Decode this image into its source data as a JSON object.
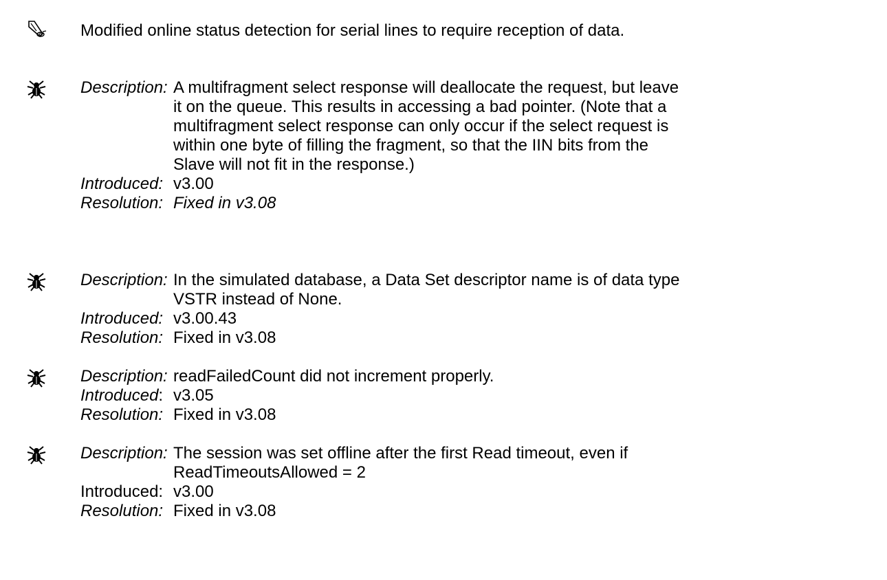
{
  "note": {
    "icon": "megaphone-icon",
    "text": "Modified online status detection for serial lines to require reception of data."
  },
  "labels": {
    "description": "Description:",
    "introduced": "Introduced:",
    "introduced_alt_colon": "Introduced",
    "colon": ":",
    "resolution": "Resolution:"
  },
  "bugs": [
    {
      "icon": "bug-spider-icon",
      "description_lines": [
        "A multifragment select response will deallocate the request, but leave",
        "it on the queue. This results in accessing a bad pointer. (Note that a",
        "multifragment select response can only occur if the select request is",
        "within one byte of filling the fragment, so that the IIN bits from the",
        "Slave will not fit in the response.)"
      ],
      "introduced": "v3.00",
      "resolution": "Fixed in v3.08"
    },
    {
      "icon": "bug-spider-icon",
      "description_lines": [
        "In the simulated database, a Data Set descriptor name is of data type",
        "VSTR instead of None."
      ],
      "introduced": "v3.00.43",
      "resolution": "Fixed in v3.08"
    },
    {
      "icon": "bug-spider-icon",
      "description_lines": [
        "readFailedCount did not increment properly."
      ],
      "introduced": "v3.05",
      "resolution": "Fixed in v3.08"
    },
    {
      "icon": "bug-spider-icon",
      "description_lines": [
        "The session was set offline after the first Read timeout, even if",
        "ReadTimeoutsAllowed = 2"
      ],
      "introduced": "v3.00",
      "resolution": "Fixed in v3.08"
    }
  ]
}
